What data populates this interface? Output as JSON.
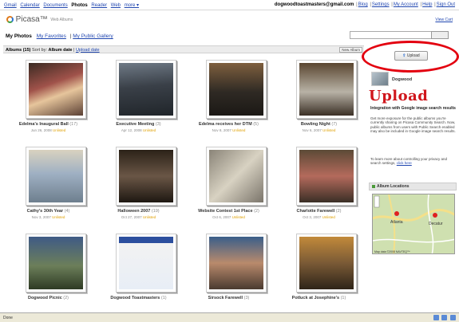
{
  "top_nav": {
    "links": [
      "Gmail",
      "Calendar",
      "Documents",
      "Photos",
      "Reader",
      "Web",
      "more ▾"
    ],
    "active": "Photos",
    "email": "dogwoodtoastmasters@gmail.com",
    "user_links": [
      "Blog",
      "Settings",
      "My Account",
      "Help",
      "Sign Out"
    ]
  },
  "header": {
    "logo_text": "Picasa™",
    "logo_sub": "Web Albums",
    "view_cart": "View Cart"
  },
  "nav_tabs": {
    "current": "My Photos",
    "links": [
      "My Favorites",
      "My Public Gallery"
    ]
  },
  "album_bar": {
    "count_label": "Albums (15)",
    "sort_label": "Sort by:",
    "sort_value": "Album date",
    "upload_date": "Upload date",
    "new_album": "New Album"
  },
  "albums": [
    {
      "title": "Edelma's Inaugural Ball",
      "count": "(17)",
      "date": "Jun 26, 2008",
      "access": "Unlisted"
    },
    {
      "title": "Executive Meeting",
      "count": "(3)",
      "date": "Apr 12, 2008",
      "access": "Unlisted"
    },
    {
      "title": "Edelma receives her DTM",
      "count": "(5)",
      "date": "Nov 8, 2007",
      "access": "Unlisted"
    },
    {
      "title": "Bowling Night",
      "count": "(7)",
      "date": "Nov 6, 2007",
      "access": "Unlisted"
    },
    {
      "title": "Cathy's 30th Year",
      "count": "(4)",
      "date": "Nov 3, 2007",
      "access": "Unlisted"
    },
    {
      "title": "Halloween 2007",
      "count": "(19)",
      "date": "Oct 27, 2007",
      "access": "Unlisted"
    },
    {
      "title": "Website Contest 1st Place",
      "count": "(2)",
      "date": "Oct 6, 2007",
      "access": "Unlisted"
    },
    {
      "title": "Charlotte Farewell",
      "count": "(2)",
      "date": "Oct 3, 2007",
      "access": "Unlisted"
    },
    {
      "title": "Dogwood Picnic",
      "count": "(2)",
      "date": "",
      "access": ""
    },
    {
      "title": "Dogwood Toastmasters",
      "count": "(1)",
      "date": "",
      "access": ""
    },
    {
      "title": "Sirsock Farewell",
      "count": "(3)",
      "date": "",
      "access": ""
    },
    {
      "title": "Potluck at Josephine's",
      "count": "(1)",
      "date": "",
      "access": ""
    }
  ],
  "sidebar": {
    "upload_button": "Upload",
    "user_name": "Dogwood",
    "annotation": "Upload",
    "heading": "Integration with Google image search results",
    "body": "Get more exposure for the public albums you're currently sharing on Picasa Community Search. Now, public albums from users with Public Search enabled may also be included in Google image search results.",
    "more_text": "To learn more about controlling your privacy and search settings,",
    "more_link": "click here",
    "locations_label": "Album Locations",
    "map_places": [
      "Atlanta",
      "Decatur"
    ],
    "map_credit": "Map data ©2008 NAVTEQ™"
  },
  "statusbar": {
    "text": "Done"
  },
  "colors": {
    "link": "#2147b0",
    "annotation_red": "#e3000f",
    "unlisted": "#e0a000"
  }
}
